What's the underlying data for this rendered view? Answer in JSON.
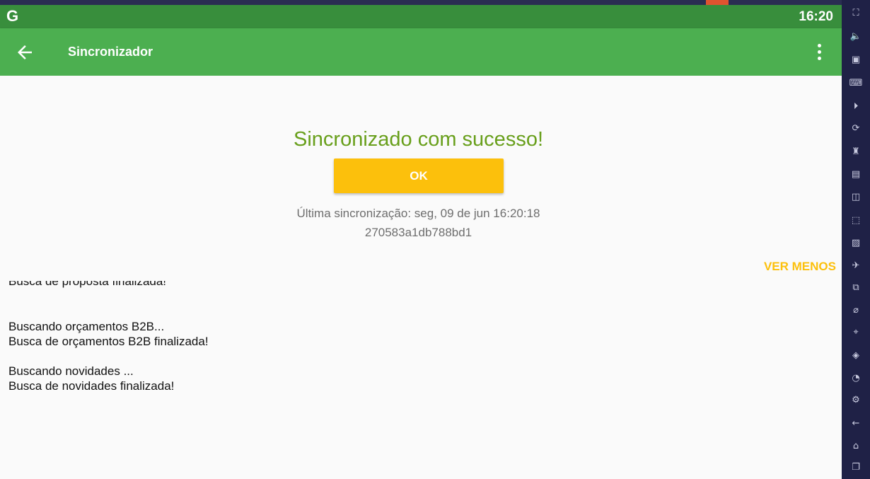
{
  "status_bar": {
    "logo": "G",
    "time": "16:20"
  },
  "app_bar": {
    "title": "Sincronizador",
    "back_icon": "arrow-left-icon",
    "menu_icon": "more-vert-icon"
  },
  "sync": {
    "message": "Sincronizado com sucesso!",
    "ok_label": "OK",
    "last_sync": "Última sincronização: seg, 09 de jun 16:20:18",
    "device_id": "270583a1db788bd1",
    "toggle_label": "VER MENOS"
  },
  "log": {
    "partial_line": "Busca de proposta finalizada!",
    "b2b_start": "Buscando orçamentos B2B...",
    "b2b_done": "Busca de orçamentos B2B finalizada!",
    "news_start": "Buscando novidades ...",
    "news_done": "Busca de novidades finalizada!"
  },
  "colors": {
    "status_bar": "#388e3c",
    "app_bar": "#4caf50",
    "success_text": "#689f1b",
    "accent": "#fcc00c",
    "sidebar": "#1f2146"
  },
  "sidebar_icons": [
    "fullscreen-icon",
    "volume-icon",
    "screen-record-icon",
    "keyboard-icon",
    "play-icon",
    "rotate-icon",
    "robot-icon",
    "apk-icon",
    "screenshot-icon",
    "crop-icon",
    "gallery-icon",
    "airplane-icon",
    "multi-window-icon",
    "erase-icon",
    "location-icon",
    "layers-icon",
    "speed-icon",
    "settings-icon",
    "back-icon",
    "home-icon",
    "recents-icon"
  ]
}
